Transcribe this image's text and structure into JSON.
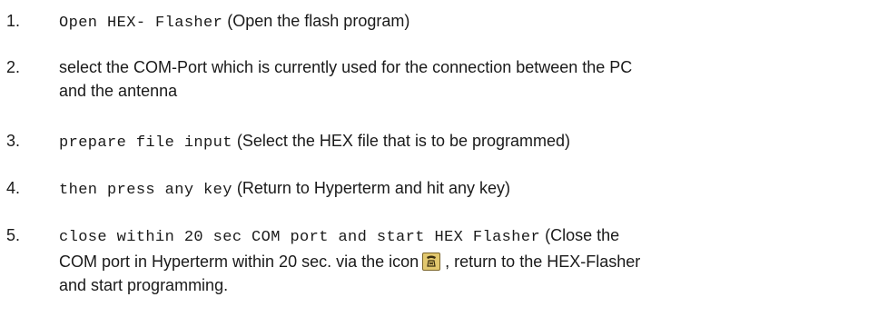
{
  "steps": [
    {
      "number": "1.",
      "code": "Open HEX- Flasher",
      "text": " (Open the flash program)"
    },
    {
      "number": "2.",
      "line1": "select the COM-Port which is currently used for the connection between the PC",
      "line2": "and the antenna"
    },
    {
      "number": "3.",
      "code": "prepare file input",
      "text": " (Select the HEX file that is to be programmed)"
    },
    {
      "number": "4.",
      "code": "then press any key",
      "text": " (Return to Hyperterm and hit any key)"
    },
    {
      "number": "5.",
      "code": "close within 20 sec COM port and start HEX Flasher",
      "text": " (Close the",
      "line2_before_icon": "COM port in Hyperterm within 20 sec. via the icon",
      "line2_after_icon": ", return to the HEX-Flasher",
      "line3": "and start programming.",
      "icon": "disconnect-phone-icon"
    }
  ]
}
